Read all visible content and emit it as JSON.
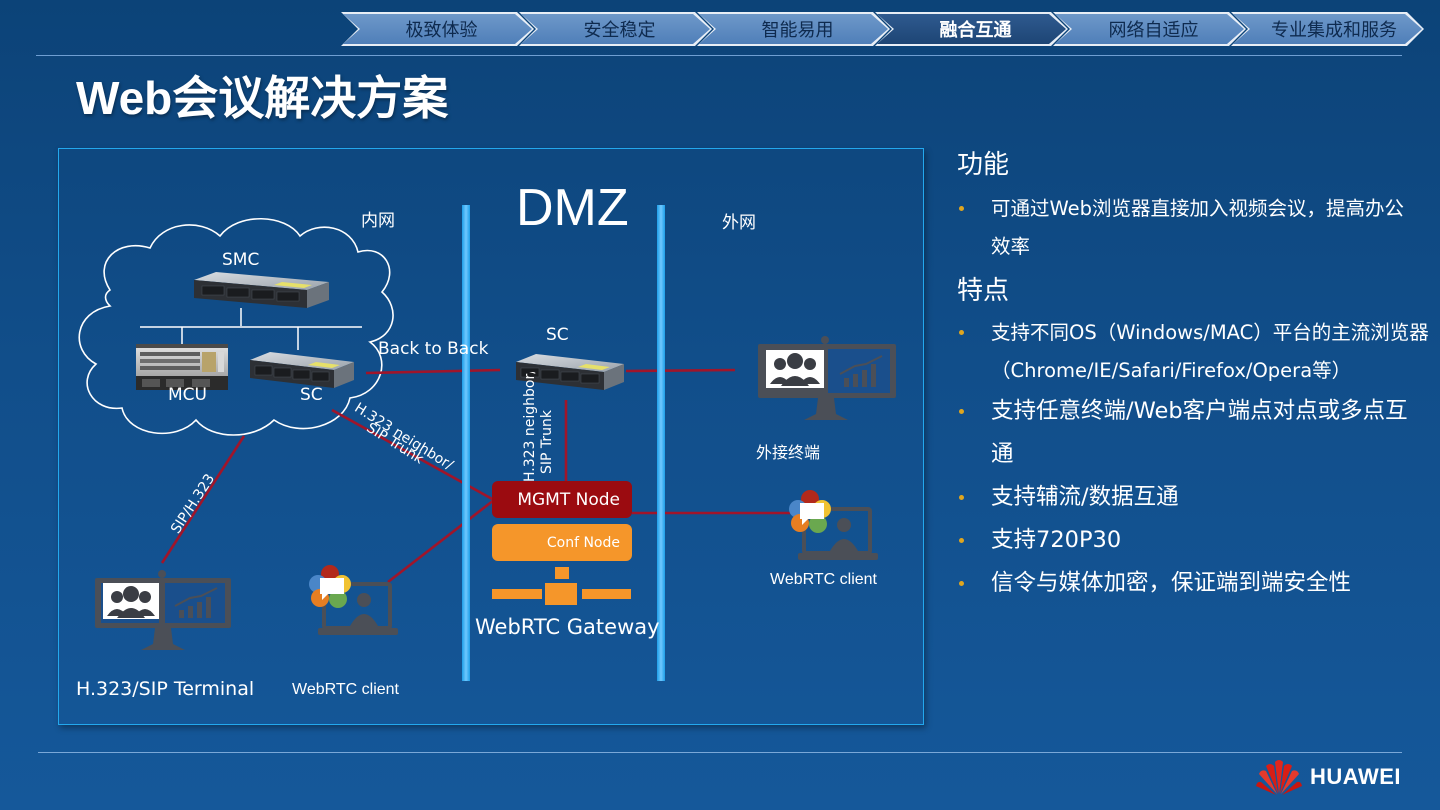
{
  "nav": {
    "tabs": [
      {
        "label": "极致体验",
        "active": false
      },
      {
        "label": "安全稳定",
        "active": false
      },
      {
        "label": "智能易用",
        "active": false
      },
      {
        "label": "融合互通",
        "active": true
      },
      {
        "label": "网络自适应",
        "active": false
      },
      {
        "label": "专业集成和服务",
        "active": false
      }
    ]
  },
  "page": {
    "title": "Web会议解决方案"
  },
  "diagram": {
    "zones": {
      "intranet": "内网",
      "dmz": "DMZ",
      "extranet": "外网"
    },
    "nodes": {
      "smc": "SMC",
      "mcu": "MCU",
      "sc_internal": "SC",
      "sc_dmz": "SC",
      "mgmt_node": "MGMT Node",
      "conf_node": "Conf Node",
      "gateway": "WebRTC Gateway",
      "h323_terminal": "H.323/SIP Terminal",
      "webrtc_client_internal": "WebRTC client",
      "external_terminal": "外接终端",
      "webrtc_client_external": "WebRTC client"
    },
    "links": {
      "back_to_back": "Back to Back",
      "h323_trunk_line1": "H.323 neighbor/",
      "h323_trunk_line2": "SIP Trunk",
      "h323_trunk_vertical_line1": "H.323 neighbor/",
      "h323_trunk_vertical_line2": "SIP Trunk",
      "sip_h323": "SIP/H.323"
    },
    "colors": {
      "link": "#a0152a",
      "mgmt_node": "#9b0b10",
      "conf_node": "#f5962a",
      "zone_bar": "#2aaaf0"
    }
  },
  "features": {
    "section1_title": "功能",
    "section1_items": [
      "可通过Web浏览器直接加入视频会议，提高办公效率"
    ],
    "section2_title": "特点",
    "section2_items": [
      {
        "text": "支持不同OS（Windows/MAC）平台的主流浏览器（Chrome/IE/Safari/Firefox/Opera等）",
        "size": "small"
      },
      {
        "text": "支持任意终端/Web客户端点对点或多点互通",
        "size": "large"
      },
      {
        "text": "支持辅流/数据互通",
        "size": "large"
      },
      {
        "text": "支持720P30",
        "size": "large"
      },
      {
        "text": "信令与媒体加密，保证端到端安全性",
        "size": "large"
      }
    ],
    "bullet_color": "#e0a61f"
  },
  "footer": {
    "brand": "HUAWEI"
  }
}
